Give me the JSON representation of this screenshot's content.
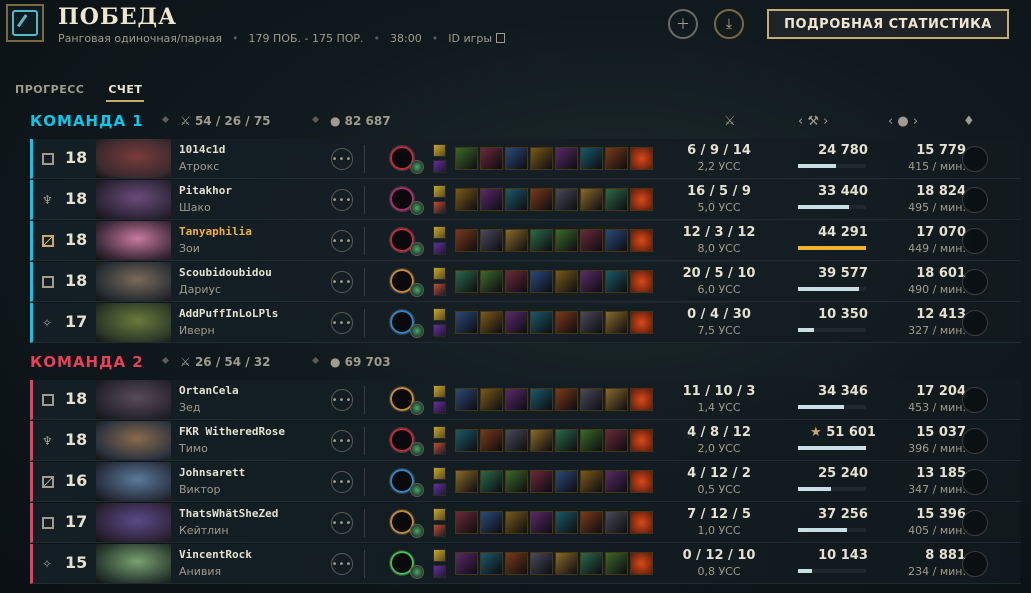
{
  "header": {
    "title": "ПОБЕДА",
    "queue": "Ранговая одиночная/парная",
    "record": "179 ПОБ. - 175 ПОР.",
    "duration": "38:00",
    "game_id_label": "ID игры",
    "stats_button": "ПОДРОБНАЯ СТАТИСТИКА"
  },
  "tabs": [
    {
      "label": "ПРОГРЕСС",
      "active": false
    },
    {
      "label": "СЧЕТ",
      "active": true
    }
  ],
  "colors": {
    "team1": "#0ac8e9",
    "team2": "#e84057",
    "accent_gold": "#c8aa6e",
    "highlight_player": "#f0b232"
  },
  "columns": {
    "kda_icon": "crossed-swords-icon",
    "damage_icon": "sword-icon",
    "gold_icon": "gold-coins-icon",
    "honor_icon": "honor-icon"
  },
  "teams": [
    {
      "name": "КОМАНДА 1",
      "kda": "54 / 26 / 75",
      "gold": "82 687",
      "players": [
        {
          "role_icon": "top-icon",
          "level": "18",
          "name": "1014c1d",
          "champion": "Атрокс",
          "kda": "6 / 9 / 14",
          "kda_ratio": "2,2 УСС",
          "damage": "24 780",
          "damage_frac": 0.56,
          "gold": "15 779",
          "gold_per_min": "415 / мин.",
          "highlight": false,
          "star": false
        },
        {
          "role_icon": "jungle-icon",
          "level": "18",
          "name": "Pitakhor",
          "champion": "Шако",
          "kda": "16 / 5 / 9",
          "kda_ratio": "5,0 УСС",
          "damage": "33 440",
          "damage_frac": 0.75,
          "gold": "18 824",
          "gold_per_min": "495 / мин.",
          "highlight": false,
          "star": false
        },
        {
          "role_icon": "mid-icon",
          "level": "18",
          "name": "Tanyaphilia",
          "champion": "Зои",
          "kda": "12 / 3 / 12",
          "kda_ratio": "8,0 УСС",
          "damage": "44 291",
          "damage_frac": 1.0,
          "gold": "17 070",
          "gold_per_min": "449 / мин.",
          "highlight": true,
          "star": false
        },
        {
          "role_icon": "bot-icon",
          "level": "18",
          "name": "Scoubidoubidou",
          "champion": "Дариус",
          "kda": "20 / 5 / 10",
          "kda_ratio": "6,0 УСС",
          "damage": "39 577",
          "damage_frac": 0.89,
          "gold": "18 601",
          "gold_per_min": "490 / мин.",
          "highlight": false,
          "star": false
        },
        {
          "role_icon": "support-icon",
          "level": "17",
          "name": "AddPuffInLoLPls",
          "champion": "Иверн",
          "kda": "0 / 4 / 30",
          "kda_ratio": "7,5 УСС",
          "damage": "10 350",
          "damage_frac": 0.23,
          "gold": "12 413",
          "gold_per_min": "327 / мин.",
          "highlight": false,
          "star": false
        }
      ]
    },
    {
      "name": "КОМАНДА 2",
      "kda": "26 / 54 / 32",
      "gold": "69 703",
      "players": [
        {
          "role_icon": "top-icon",
          "level": "18",
          "name": "OrtanCela",
          "champion": "Зед",
          "kda": "11 / 10 / 3",
          "kda_ratio": "1,4 УСС",
          "damage": "34 346",
          "damage_frac": 0.67,
          "gold": "17 204",
          "gold_per_min": "453 / мин.",
          "highlight": false,
          "star": false
        },
        {
          "role_icon": "jungle-icon",
          "level": "18",
          "name": "FKR WitheredRose",
          "champion": "Тимо",
          "kda": "4 / 8 / 12",
          "kda_ratio": "2,0 УСС",
          "damage": "51 601",
          "damage_frac": 1.0,
          "gold": "15 037",
          "gold_per_min": "396 / мин.",
          "highlight": false,
          "star": true
        },
        {
          "role_icon": "mid-icon",
          "level": "16",
          "name": "Johnsarett",
          "champion": "Виктор",
          "kda": "4 / 12 / 2",
          "kda_ratio": "0,5 УСС",
          "damage": "25 240",
          "damage_frac": 0.49,
          "gold": "13 185",
          "gold_per_min": "347 / мин.",
          "highlight": false,
          "star": false
        },
        {
          "role_icon": "bot-icon",
          "level": "17",
          "name": "ThatsWhätSheZed",
          "champion": "Кейтлин",
          "kda": "7 / 12 / 5",
          "kda_ratio": "1,0 УСС",
          "damage": "37 256",
          "damage_frac": 0.72,
          "gold": "15 396",
          "gold_per_min": "405 / мин.",
          "highlight": false,
          "star": false
        },
        {
          "role_icon": "support-icon",
          "level": "15",
          "name": "VincentRock",
          "champion": "Анивия",
          "kda": "0 / 12 / 10",
          "kda_ratio": "0,8 УСС",
          "damage": "10 143",
          "damage_frac": 0.2,
          "gold": "8 881",
          "gold_per_min": "234 / мин.",
          "highlight": false,
          "star": false
        }
      ]
    }
  ]
}
